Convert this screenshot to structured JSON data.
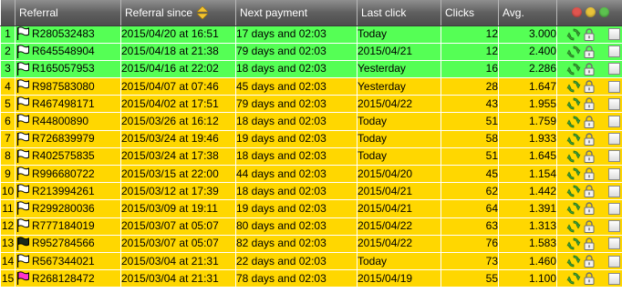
{
  "header": {
    "num": "",
    "referral": "Referral",
    "since": "Referral since",
    "next": "Next payment",
    "last": "Last click",
    "clicks": "Clicks",
    "avg": "Avg."
  },
  "colors": {
    "green_row": "#55ff55",
    "yellow_row": "#ffd700",
    "win_red": "#e0554f",
    "win_yellow": "#e8c33a",
    "win_green": "#5cc24f"
  },
  "rows": [
    {
      "num": "1",
      "ref": "R280532483",
      "since": "2015/04/20 at 16:51",
      "next": "17 days and 02:03",
      "last": "Today",
      "clicks": "12",
      "avg": "3.000",
      "tone": "green",
      "flag": "white"
    },
    {
      "num": "2",
      "ref": "R645548904",
      "since": "2015/04/18 at 21:38",
      "next": "79 days and 02:03",
      "last": "2015/04/21",
      "clicks": "12",
      "avg": "2.400",
      "tone": "green",
      "flag": "white"
    },
    {
      "num": "3",
      "ref": "R165057953",
      "since": "2015/04/16 at 22:02",
      "next": "18 days and 02:03",
      "last": "Yesterday",
      "clicks": "16",
      "avg": "2.286",
      "tone": "green",
      "flag": "white"
    },
    {
      "num": "4",
      "ref": "R987583080",
      "since": "2015/04/07 at 07:46",
      "next": "45 days and 02:03",
      "last": "Yesterday",
      "clicks": "28",
      "avg": "1.647",
      "tone": "yellow",
      "flag": "white"
    },
    {
      "num": "5",
      "ref": "R467498171",
      "since": "2015/04/02 at 17:51",
      "next": "79 days and 02:03",
      "last": "2015/04/22",
      "clicks": "43",
      "avg": "1.955",
      "tone": "yellow",
      "flag": "white"
    },
    {
      "num": "6",
      "ref": "R44800890",
      "since": "2015/03/26 at 16:12",
      "next": "18 days and 02:03",
      "last": "Today",
      "clicks": "51",
      "avg": "1.759",
      "tone": "yellow",
      "flag": "white"
    },
    {
      "num": "7",
      "ref": "R726839979",
      "since": "2015/03/24 at 19:46",
      "next": "19 days and 02:03",
      "last": "Today",
      "clicks": "58",
      "avg": "1.933",
      "tone": "yellow",
      "flag": "white"
    },
    {
      "num": "8",
      "ref": "R402575835",
      "since": "2015/03/24 at 17:38",
      "next": "18 days and 02:03",
      "last": "Today",
      "clicks": "51",
      "avg": "1.645",
      "tone": "yellow",
      "flag": "white"
    },
    {
      "num": "9",
      "ref": "R996680722",
      "since": "2015/03/15 at 22:00",
      "next": "44 days and 02:03",
      "last": "2015/04/20",
      "clicks": "45",
      "avg": "1.154",
      "tone": "yellow",
      "flag": "white"
    },
    {
      "num": "10",
      "ref": "R213994261",
      "since": "2015/03/12 at 17:39",
      "next": "18 days and 02:03",
      "last": "2015/04/21",
      "clicks": "62",
      "avg": "1.442",
      "tone": "yellow",
      "flag": "white"
    },
    {
      "num": "11",
      "ref": "R299280036",
      "since": "2015/03/09 at 19:11",
      "next": "19 days and 02:03",
      "last": "2015/04/21",
      "clicks": "64",
      "avg": "1.391",
      "tone": "yellow",
      "flag": "white"
    },
    {
      "num": "12",
      "ref": "R777184019",
      "since": "2015/03/07 at 05:07",
      "next": "80 days and 02:03",
      "last": "2015/04/22",
      "clicks": "63",
      "avg": "1.313",
      "tone": "yellow",
      "flag": "white"
    },
    {
      "num": "13",
      "ref": "R952784566",
      "since": "2015/03/07 at 05:07",
      "next": "82 days and 02:03",
      "last": "2015/04/22",
      "clicks": "76",
      "avg": "1.583",
      "tone": "yellow",
      "flag": "black"
    },
    {
      "num": "14",
      "ref": "R567344021",
      "since": "2015/03/04 at 21:31",
      "next": "22 days and 02:03",
      "last": "Today",
      "clicks": "73",
      "avg": "1.460",
      "tone": "yellow",
      "flag": "white"
    },
    {
      "num": "15",
      "ref": "R268128472",
      "since": "2015/03/04 at 21:31",
      "next": "78 days and 02:03",
      "last": "2015/04/19",
      "clicks": "55",
      "avg": "1.100",
      "tone": "yellow",
      "flag": "magenta"
    }
  ],
  "icons": {
    "flag": "flag-icon",
    "recycle": "recycle-icon",
    "lock": "lock-icon",
    "checkbox": "row-checkbox",
    "sort": "sort-arrows-icon"
  }
}
